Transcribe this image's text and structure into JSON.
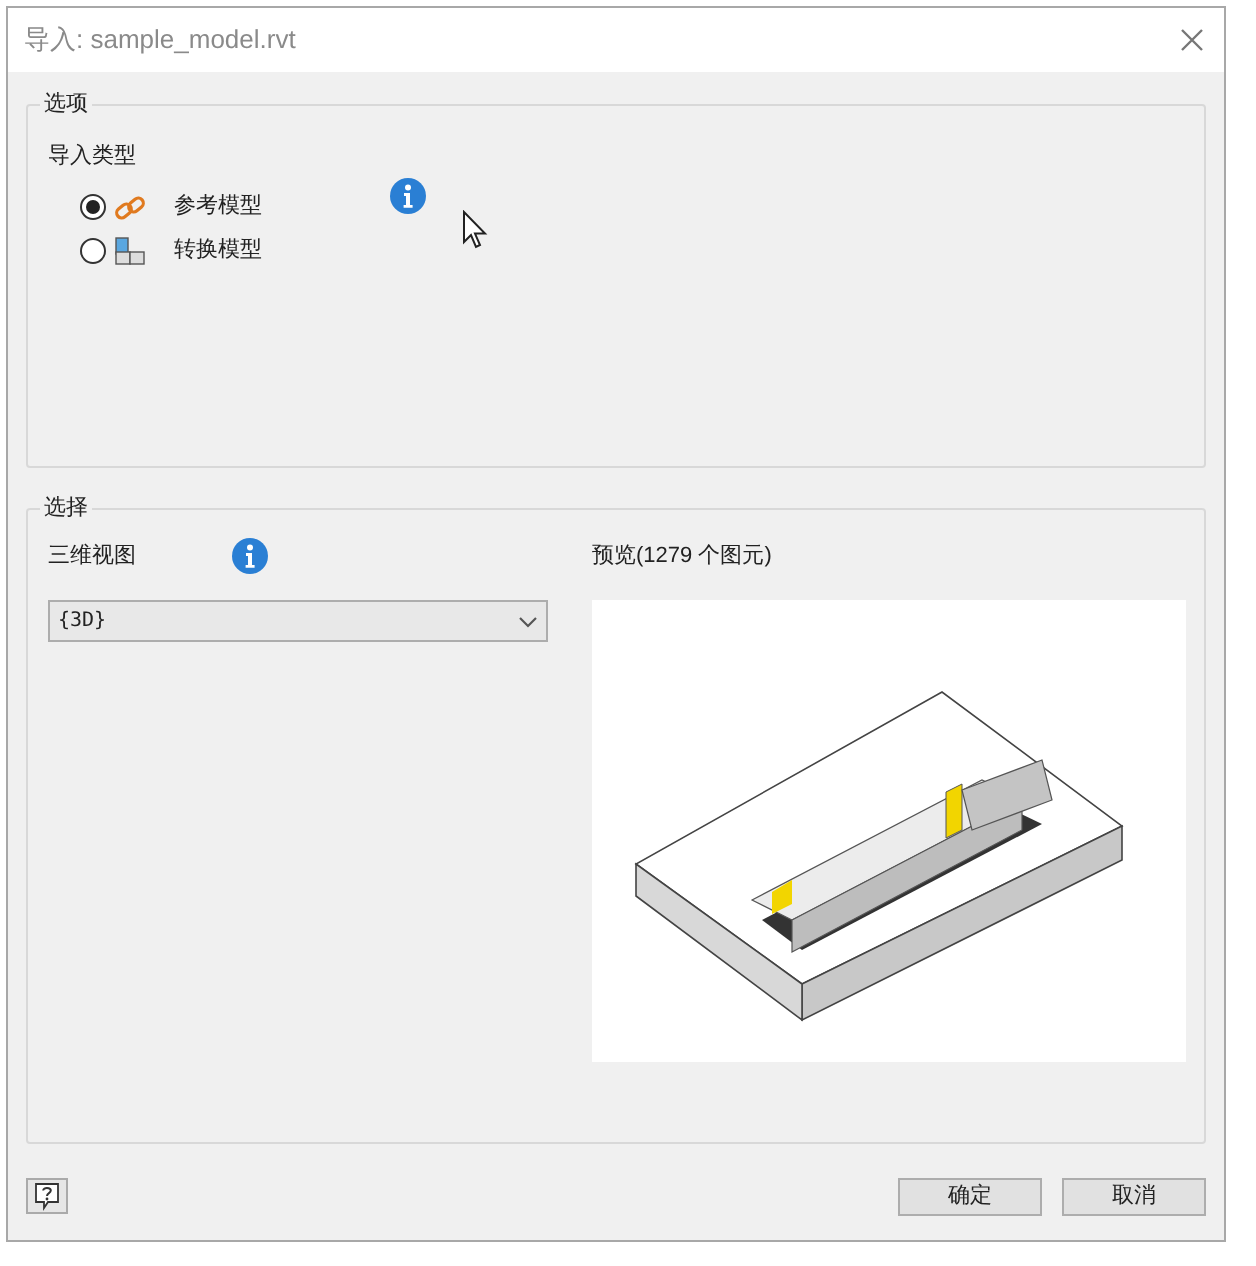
{
  "window": {
    "title": "导入: sample_model.rvt"
  },
  "options_group": {
    "title": "选项",
    "import_type_label": "导入类型",
    "radios": [
      {
        "label": "参考模型",
        "kind": "link",
        "selected": true
      },
      {
        "label": "转换模型",
        "kind": "blocks",
        "selected": false
      }
    ]
  },
  "selection_group": {
    "title": "选择",
    "view_label": "三维视图",
    "view_dropdown": {
      "value": "{3D}"
    },
    "preview_label": "预览(1279 个图元)"
  },
  "buttons": [
    {
      "label": "确定"
    },
    {
      "label": "取消"
    }
  ]
}
